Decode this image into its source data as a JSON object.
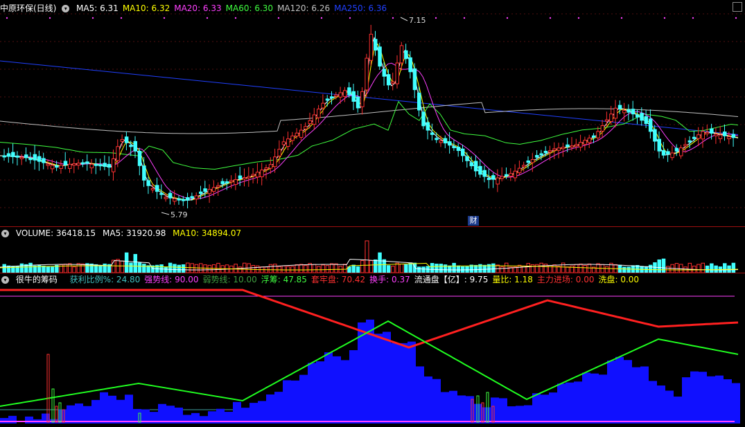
{
  "main_panel": {
    "title": "中原环保(日线)",
    "ma": [
      {
        "label": "MA5: 6.31",
        "color": "#ffffff"
      },
      {
        "label": "MA10: 6.32",
        "color": "#ffff00"
      },
      {
        "label": "MA20: 6.33",
        "color": "#ff40ff"
      },
      {
        "label": "MA60: 6.30",
        "color": "#40ff40"
      },
      {
        "label": "MA120: 6.26",
        "color": "#c0c0c0"
      },
      {
        "label": "MA250: 6.36",
        "color": "#2040ff"
      }
    ],
    "high_marker": "7.15",
    "low_marker": "5.79",
    "finance_tag": "财"
  },
  "volume_panel": {
    "label": "VOLUME: 36418.15",
    "ma5": "MA5: 31920.98",
    "ma10": "MA10: 34894.07"
  },
  "indicator_panel": {
    "name": "很牛的筹码",
    "items": [
      {
        "label": "获利比例%: 24.80",
        "color": "#40c0c0"
      },
      {
        "label": "强势线: 90.00",
        "color": "#ff40ff"
      },
      {
        "label": "弱势线: 10.00",
        "color": "#40a040"
      },
      {
        "label": "浮筹: 47.85",
        "color": "#40ff40"
      },
      {
        "label": "套牢盘: 70.42",
        "color": "#ff3030"
      },
      {
        "label": "换手: 0.37",
        "color": "#ff40ff"
      },
      {
        "label": "流通盘【亿】: 9.75",
        "color": "#ffffff"
      },
      {
        "label": "量比: 1.18",
        "color": "#ffff00"
      },
      {
        "label": "主力进场: 0.00",
        "color": "#ff3030"
      },
      {
        "label": "洗盘: 0.00",
        "color": "#ffff00"
      }
    ]
  },
  "colors": {
    "up": "#ff3030",
    "down": "#40ffff",
    "bg": "#000000",
    "grid": "#a01010"
  }
}
